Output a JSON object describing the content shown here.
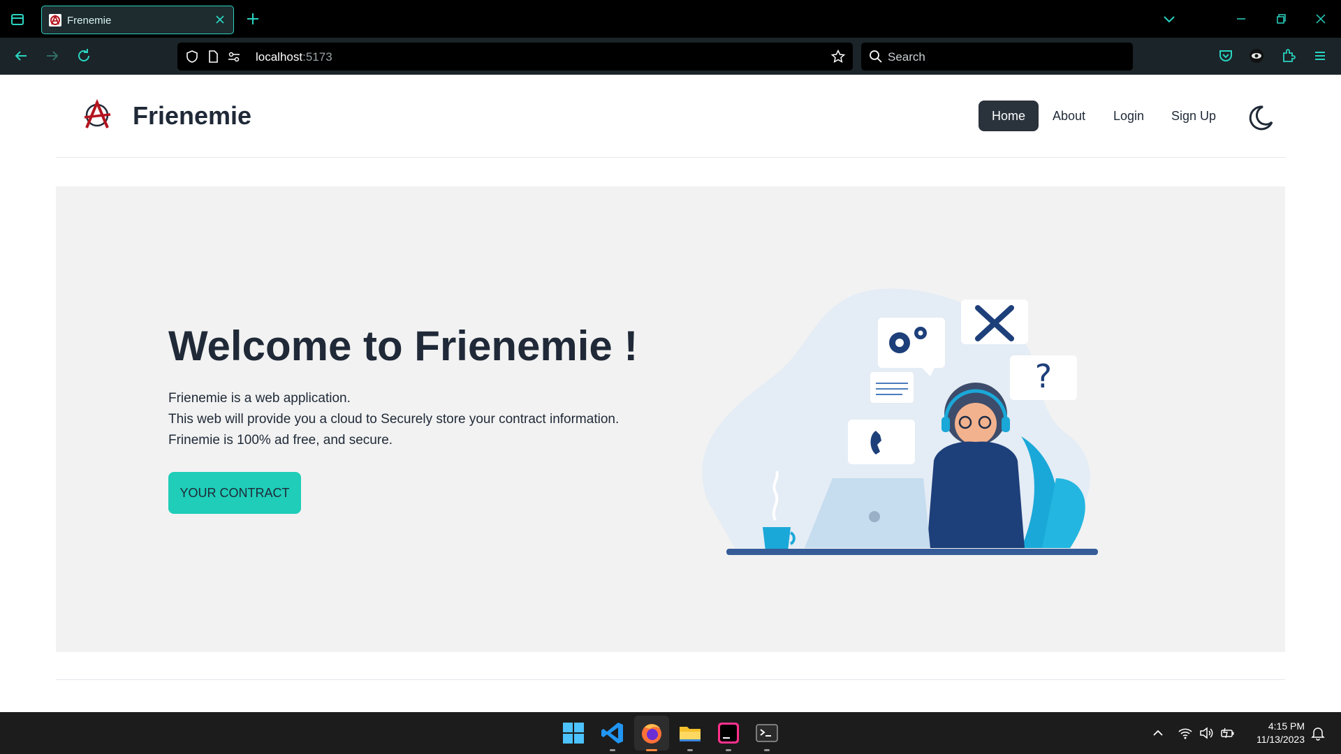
{
  "browser": {
    "tab_title": "Frenemie",
    "url_host": "localhost",
    "url_port": ":5173",
    "search_placeholder": "Search",
    "accent_color": "#2ad4c1"
  },
  "site": {
    "brand": "Frienemie",
    "nav": [
      {
        "label": "Home",
        "active": true
      },
      {
        "label": "About",
        "active": false
      },
      {
        "label": "Login",
        "active": false
      },
      {
        "label": "Sign Up",
        "active": false
      }
    ],
    "theme_toggle_icon": "moon-icon"
  },
  "hero": {
    "title": "Welcome to Frienemie !",
    "lines": [
      "Frienemie is a web application.",
      "This web will provide you a cloud to Securely store your contract information.",
      "Frinemie is 100% ad free, and secure."
    ],
    "cta_label": "YOUR CONTRACT",
    "cta_color": "#1fcdb8"
  },
  "taskbar": {
    "time": "4:15 PM",
    "date": "11/13/2023"
  }
}
